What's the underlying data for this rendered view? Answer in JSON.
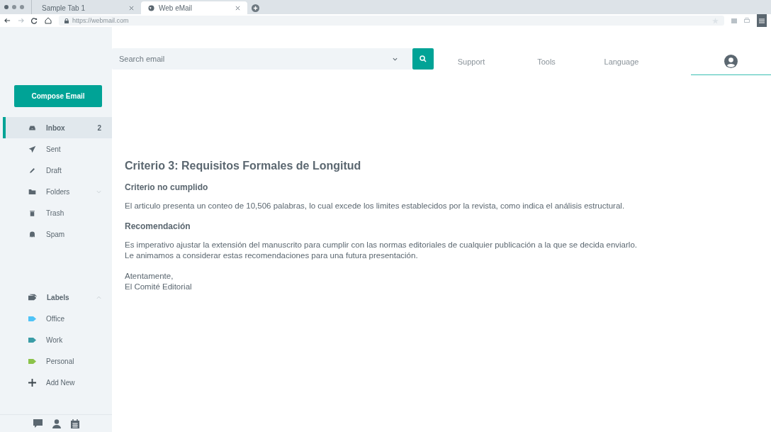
{
  "browser": {
    "tabs": [
      {
        "label": "Sample Tab 1",
        "selected": false
      },
      {
        "label": "Web eMail",
        "selected": true
      }
    ],
    "url": "https://webmail.com"
  },
  "search": {
    "placeholder": "Search email"
  },
  "nav": [
    {
      "kind": "text",
      "label": "Support",
      "selected": false
    },
    {
      "kind": "text",
      "label": "Tools",
      "selected": false
    },
    {
      "kind": "text",
      "label": "Language",
      "selected": false
    },
    {
      "kind": "avatar",
      "selected": true
    }
  ],
  "compose": "Compose Email",
  "folders": [
    {
      "label": "Inbox",
      "count": "2",
      "selected": true
    },
    {
      "label": "Sent",
      "selected": false
    },
    {
      "label": "Draft",
      "selected": false
    },
    {
      "label": "Folders",
      "selected": false,
      "expanded": false
    },
    {
      "label": "Trash",
      "selected": false
    },
    {
      "label": "Spam",
      "selected": false
    }
  ],
  "labels": {
    "title": "Labels",
    "expanded": true,
    "items": [
      {
        "label": "Office",
        "color": "#4fc3f7"
      },
      {
        "label": "Work",
        "color": "#3a9ca6"
      },
      {
        "label": "Personal",
        "color": "#8bc34a"
      }
    ],
    "add": "Add New"
  },
  "message": {
    "title": "Criterio 3: Requisitos Formales de Longitud",
    "blocks": [
      {
        "kind": "heading",
        "text": "Criterio no cumplido"
      },
      {
        "kind": "paragraph",
        "text": "El articulo presenta un conteo de 10,506 palabras, lo cual excede los limites establecidos por la revista, como indica el análisis estructural."
      },
      {
        "kind": "heading",
        "text": "Recomendación"
      },
      {
        "kind": "paragraph",
        "text": "Es imperativo ajustar la extensión del manuscrito para cumplir con las normas editoriales de cualquier publicación a la que se decida enviarlo.\nLe animamos a considerar estas recomendaciones para una futura presentación."
      },
      {
        "kind": "paragraph",
        "text": "Atentamente,\nEl Comité Editorial"
      }
    ]
  }
}
